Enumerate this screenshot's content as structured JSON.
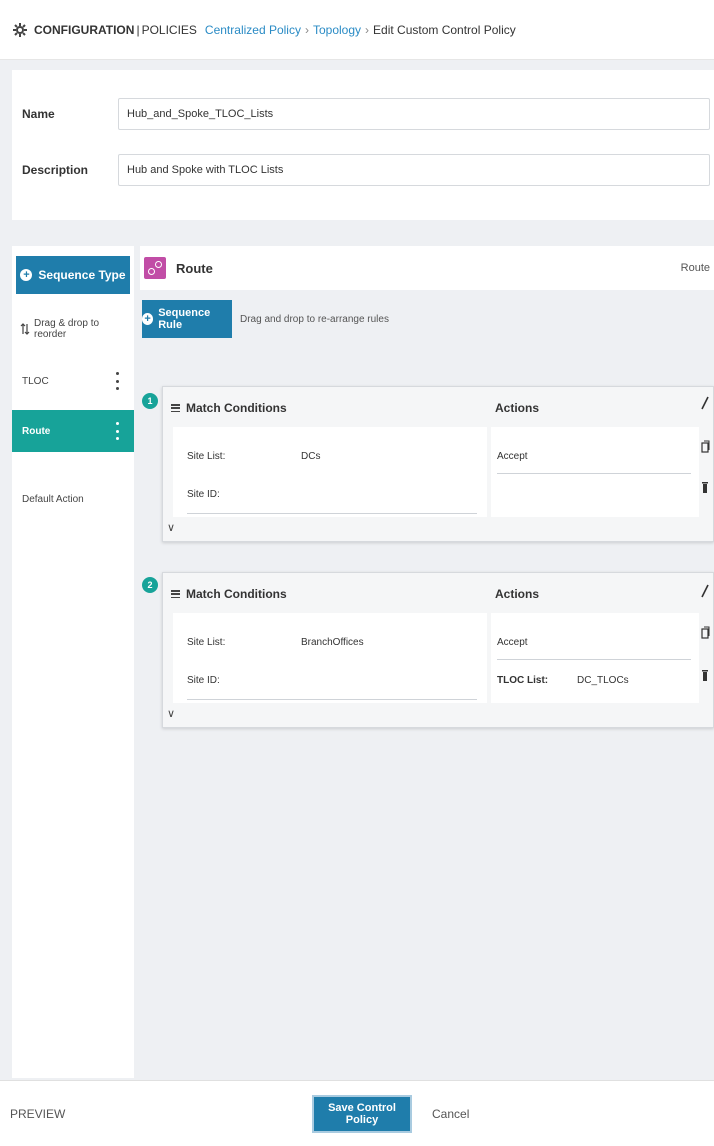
{
  "header": {
    "section": "CONFIGURATION",
    "separator": "|",
    "subsection": "POLICIES",
    "breadcrumbs": [
      "Centralized Policy",
      "Topology"
    ],
    "current": "Edit Custom Control Policy",
    "chevron": "›"
  },
  "form": {
    "name_label": "Name",
    "name_value": "Hub_and_Spoke_TLOC_Lists",
    "description_label": "Description",
    "description_value": "Hub and Spoke with TLOC Lists"
  },
  "sidebar": {
    "sequence_type_label": "Sequence Type",
    "drag_hint": "Drag & drop to reorder",
    "items": [
      {
        "label": "TLOC",
        "active": false
      },
      {
        "label": "Route",
        "active": true
      },
      {
        "label": "Default Action",
        "active": false
      }
    ]
  },
  "main": {
    "title": "Route",
    "right_label": "Route",
    "sequence_rule_label": "Sequence Rule",
    "sequence_rule_hint": "Drag and drop to re-arrange rules",
    "match_header": "Match Conditions",
    "actions_header": "Actions",
    "rules": [
      {
        "number": "1",
        "site_list_label": "Site List:",
        "site_list_value": "DCs",
        "site_id_label": "Site ID:",
        "action": "Accept"
      },
      {
        "number": "2",
        "site_list_label": "Site List:",
        "site_list_value": "BranchOffices",
        "site_id_label": "Site ID:",
        "action": "Accept",
        "tloc_list_label": "TLOC List:",
        "tloc_list_value": "DC_TLOCs"
      }
    ]
  },
  "footer": {
    "preview_label": "PREVIEW",
    "save_label": "Save Control Policy",
    "cancel_label": "Cancel"
  },
  "colors": {
    "primary_blue": "#1f7dab",
    "teal": "#17a399",
    "route_icon": "#c14da6"
  }
}
